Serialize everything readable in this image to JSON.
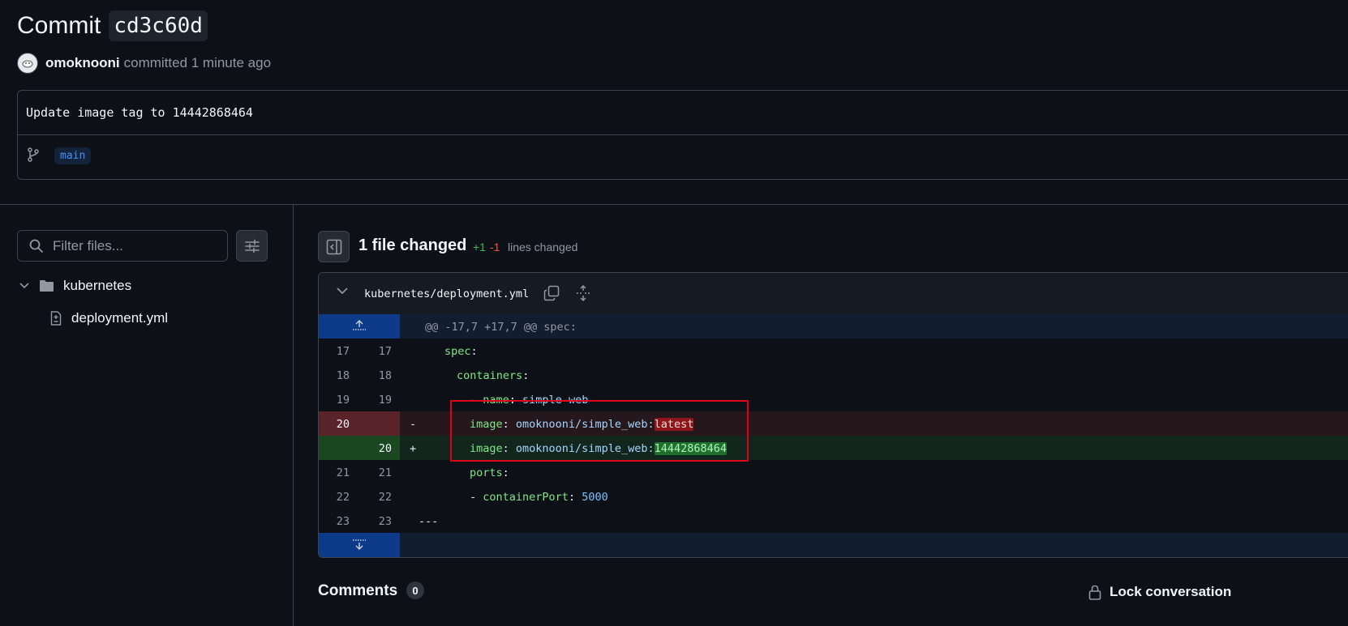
{
  "header": {
    "title_prefix": "Commit",
    "sha": "cd3c60d",
    "author": "omoknooni",
    "committed_text": "committed 1 minute ago",
    "message": "Update image tag to 14442868464",
    "branch": "main"
  },
  "sidebar": {
    "filter_placeholder": "Filter files...",
    "tree": {
      "folder": "kubernetes",
      "file": "deployment.yml"
    }
  },
  "summary": {
    "files_changed": "1 file changed",
    "additions": "+1",
    "deletions": "-1",
    "lines_changed": "lines changed"
  },
  "diff": {
    "file_path": "kubernetes/deployment.yml",
    "hunk_header": "@@ -17,7 +17,7 @@ spec:",
    "lines": [
      {
        "old": "17",
        "new": "17",
        "sign": "",
        "key": "spec",
        "sep": ":",
        "value": ""
      },
      {
        "old": "18",
        "new": "18",
        "sign": "",
        "key": "containers",
        "sep": ":",
        "value": ""
      },
      {
        "old": "19",
        "new": "19",
        "sign": "",
        "dash": "- ",
        "key": "name",
        "sep": ": ",
        "value": "simple-web"
      },
      {
        "old": "20",
        "new": "",
        "sign": "-",
        "key": "image",
        "sep": ": ",
        "value": "omoknooni/simple_web:",
        "hl": "latest"
      },
      {
        "old": "",
        "new": "20",
        "sign": "+",
        "key": "image",
        "sep": ": ",
        "value": "omoknooni/simple_web:",
        "hl": "14442868464"
      },
      {
        "old": "21",
        "new": "21",
        "sign": "",
        "key": "ports",
        "sep": ":",
        "value": ""
      },
      {
        "old": "22",
        "new": "22",
        "sign": "",
        "dash": "- ",
        "key": "containerPort",
        "sep": ": ",
        "value": "5000"
      },
      {
        "old": "23",
        "new": "23",
        "sign": "",
        "plain": "---"
      }
    ]
  },
  "comments": {
    "label": "Comments",
    "count": "0",
    "lock_label": "Lock conversation"
  },
  "colors": {
    "background": "#0d1117",
    "deletion": "#f85149",
    "addition": "#3fb950",
    "accent": "#4493f8",
    "annotation_box": "#e0001b"
  },
  "icons": [
    "avatar",
    "git-branch-icon",
    "search-icon",
    "sliders-icon",
    "chevron-down-icon",
    "folder-icon",
    "file-diff-icon",
    "sidebar-toggle-icon",
    "copy-icon",
    "unfold-icon",
    "expand-up-icon",
    "expand-down-icon",
    "lock-icon"
  ]
}
